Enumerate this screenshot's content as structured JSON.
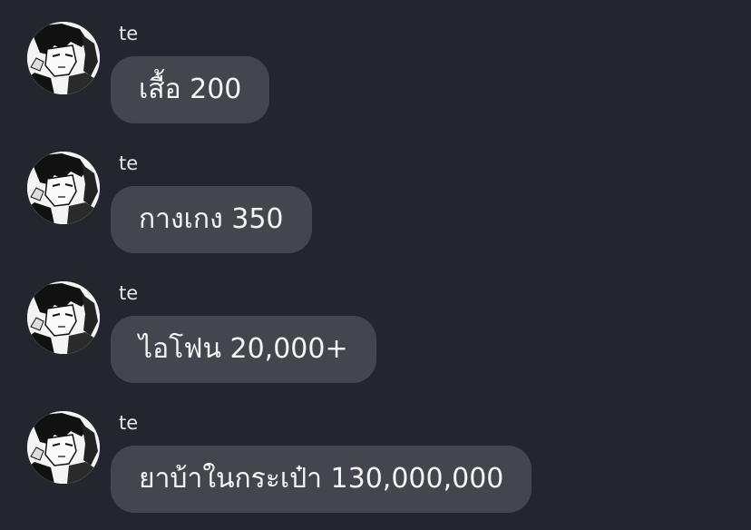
{
  "messages": [
    {
      "sender": "te",
      "text": "เสื้อ 200"
    },
    {
      "sender": "te",
      "text": "กางเกง 350"
    },
    {
      "sender": "te",
      "text": "ไอโฟน 20,000+"
    },
    {
      "sender": "te",
      "text": "ยาบ้าในกระเป๋า 130,000,000"
    }
  ],
  "colors": {
    "background": "#24262d",
    "bubble": "#44464e",
    "text": "#f4f4f6",
    "sender": "#e6e6e8"
  }
}
